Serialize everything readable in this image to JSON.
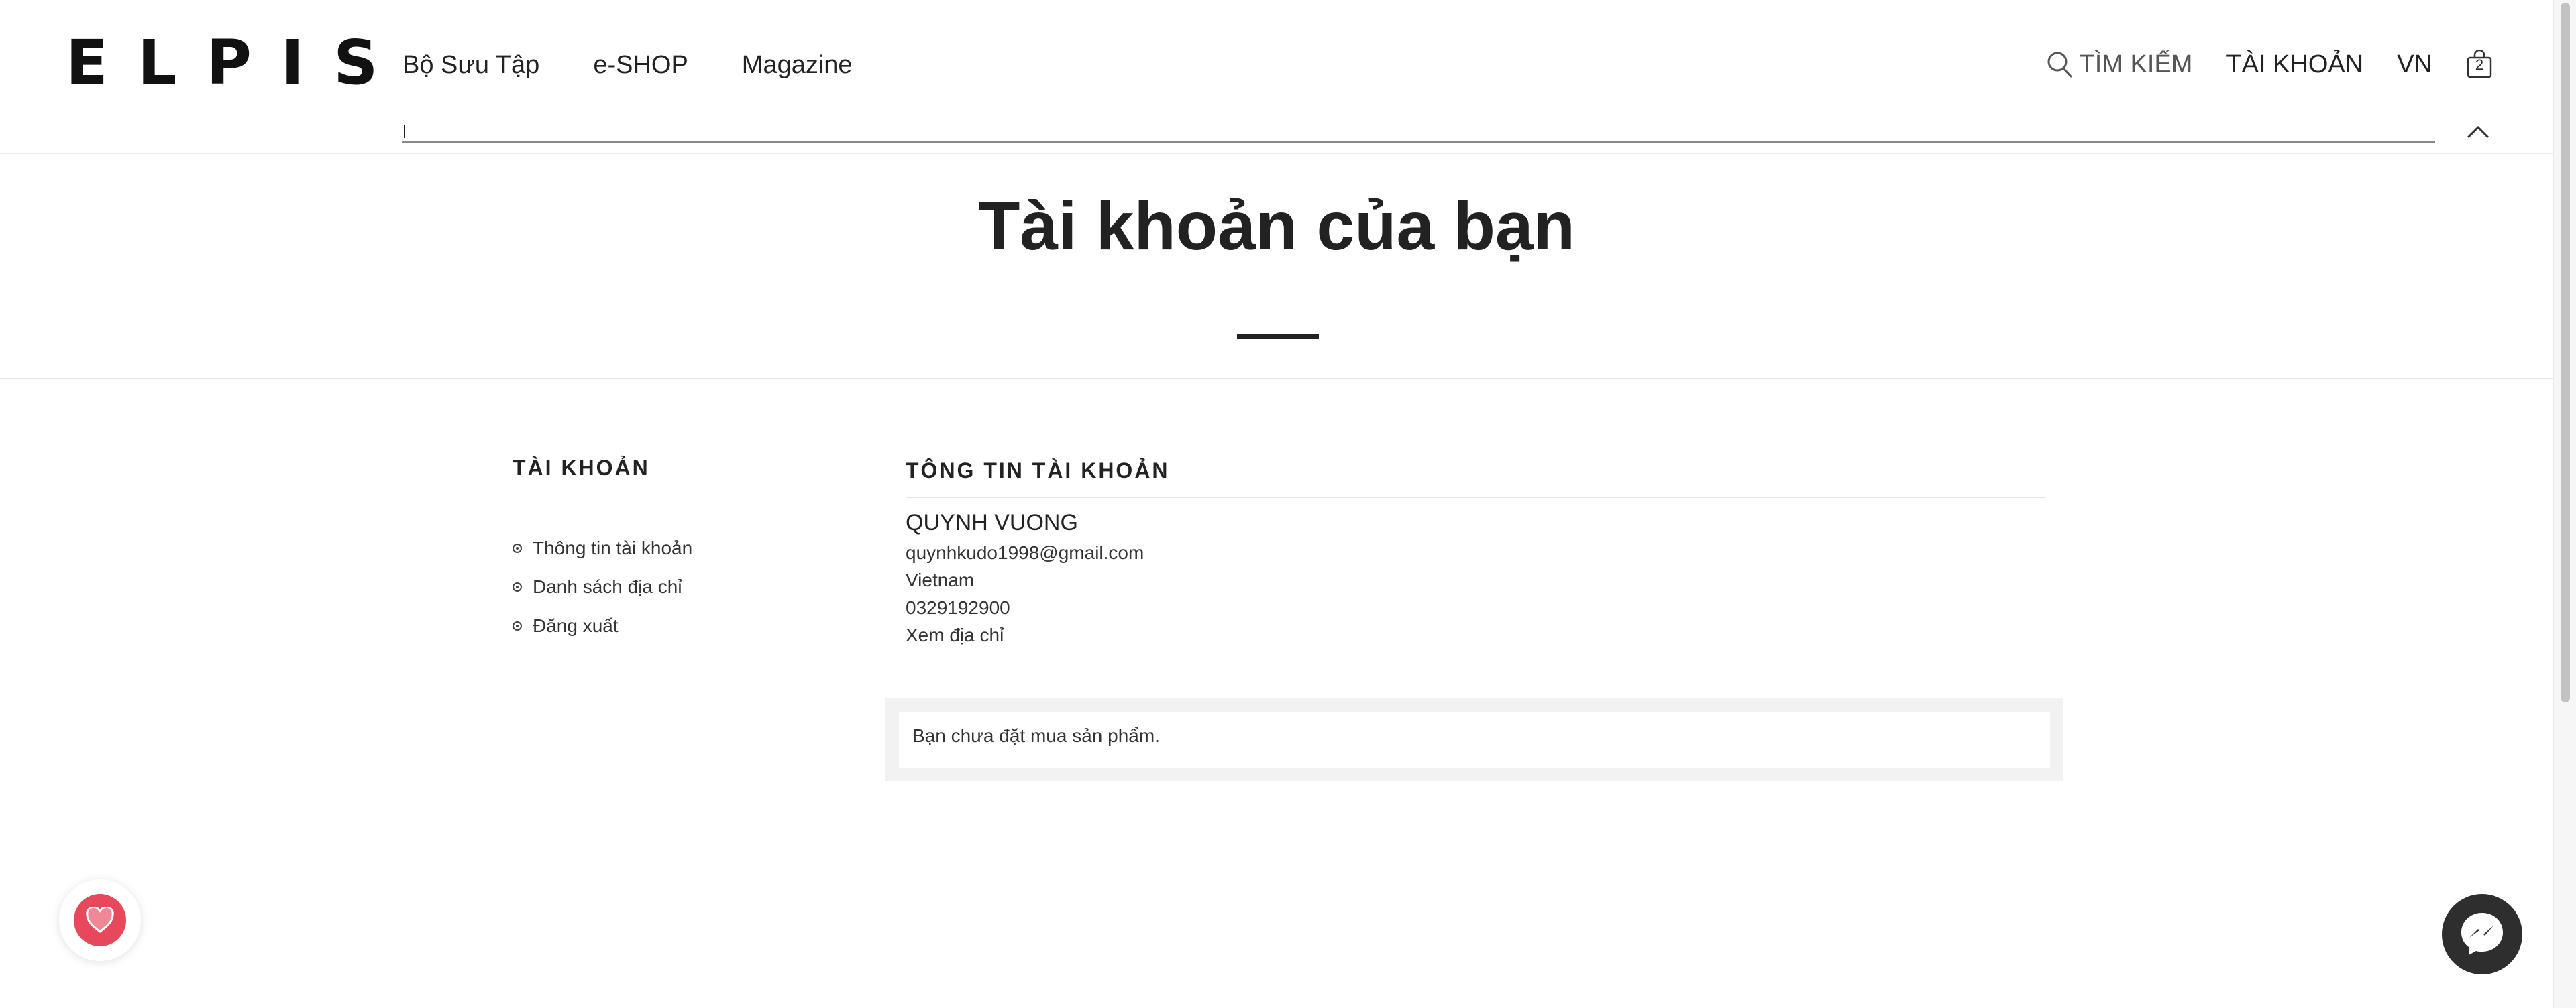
{
  "header": {
    "logo": "ELPIS",
    "nav": [
      "Bộ Sưu Tập",
      "e-SHOP",
      "Magazine"
    ],
    "search_label": "TÌM KIẾM",
    "account_label": "TÀI KHOẢN",
    "language": "VN",
    "cart_count": "2"
  },
  "page": {
    "title": "Tài khoản của bạn"
  },
  "sidebar": {
    "title": "TÀI KHOẢN",
    "items": [
      "Thông tin tài khoản",
      "Danh sách địa chỉ",
      "Đăng xuất"
    ]
  },
  "account_info": {
    "section_title": "TÔNG TIN TÀI KHOẢN",
    "name": "QUYNH VUONG",
    "email": "quynhkudo1998@gmail.com",
    "country": "Vietnam",
    "phone": "0329192900",
    "view_address": "Xem địa chỉ"
  },
  "orders": {
    "empty_message": "Bạn chưa đặt mua sản phẩm."
  },
  "icons": {
    "search": "search-icon",
    "cart": "shopping-bag-icon",
    "collapse": "chevron-up-icon",
    "wishlist": "heart-icon",
    "messenger": "messenger-icon"
  },
  "colors": {
    "text": "#222222",
    "wishlist_accent": "#e8485c",
    "messenger_bg": "#2e2e2e"
  }
}
